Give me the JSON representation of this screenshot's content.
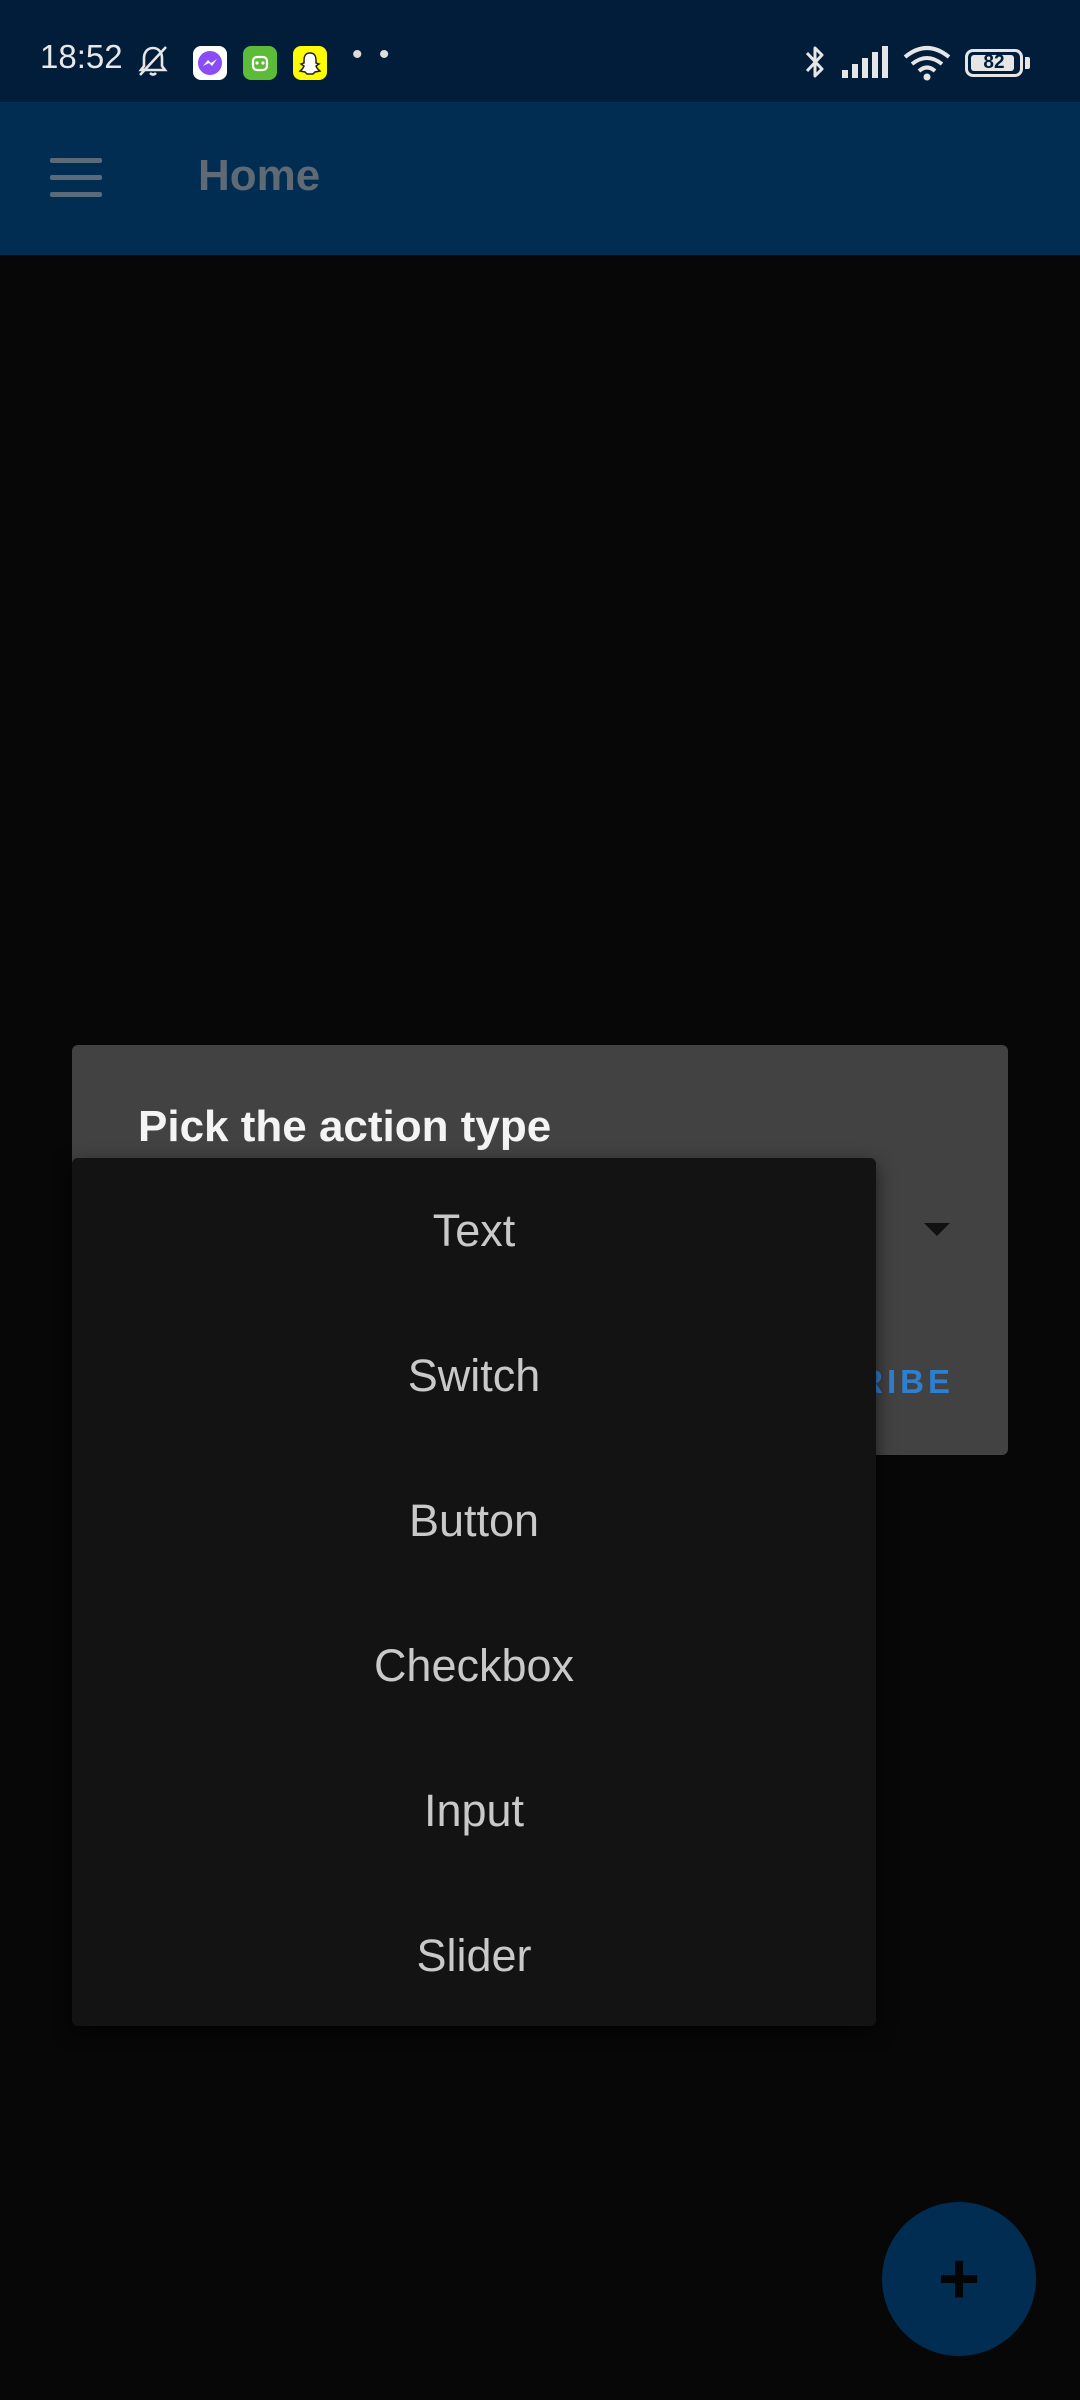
{
  "status_bar": {
    "time": "18:52",
    "battery_level": "82",
    "icons": [
      "muted-alarm-icon",
      "messenger-icon",
      "android-app-icon",
      "snapchat-icon",
      "more-dots-icon",
      "bluetooth-icon",
      "signal-icon",
      "wifi-icon",
      "battery-icon"
    ],
    "dots": "• •"
  },
  "app_bar": {
    "title": "Home",
    "menu_icon": "hamburger-menu-icon"
  },
  "dialog": {
    "title": "Pick the action type",
    "action_label": "RIBE"
  },
  "dropdown": {
    "items": [
      {
        "label": "Text"
      },
      {
        "label": "Switch"
      },
      {
        "label": "Button"
      },
      {
        "label": "Checkbox"
      },
      {
        "label": "Input"
      },
      {
        "label": "Slider"
      }
    ]
  },
  "fab": {
    "label": "+",
    "icon": "plus-icon"
  },
  "colors": {
    "status_bar_bg": "#011d3a",
    "app_bar_bg": "#022d53",
    "dialog_bg": "#424242",
    "menu_bg": "#131313",
    "accent": "#2f7fd0"
  }
}
